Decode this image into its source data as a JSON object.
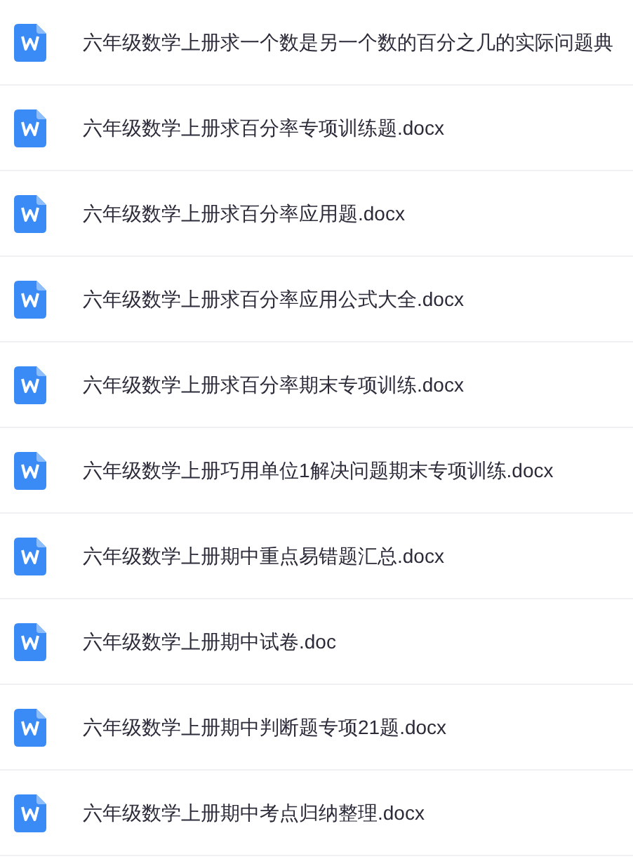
{
  "files": [
    {
      "name": "六年级数学上册求一个数是另一个数的百分之几的实际问题典"
    },
    {
      "name": "六年级数学上册求百分率专项训练题.docx"
    },
    {
      "name": "六年级数学上册求百分率应用题.docx"
    },
    {
      "name": "六年级数学上册求百分率应用公式大全.docx"
    },
    {
      "name": "六年级数学上册求百分率期末专项训练.docx"
    },
    {
      "name": "六年级数学上册巧用单位1解决问题期末专项训练.docx"
    },
    {
      "name": "六年级数学上册期中重点易错题汇总.docx"
    },
    {
      "name": "六年级数学上册期中试卷.doc"
    },
    {
      "name": "六年级数学上册期中判断题专项21题.docx"
    },
    {
      "name": "六年级数学上册期中考点归纳整理.docx"
    }
  ]
}
